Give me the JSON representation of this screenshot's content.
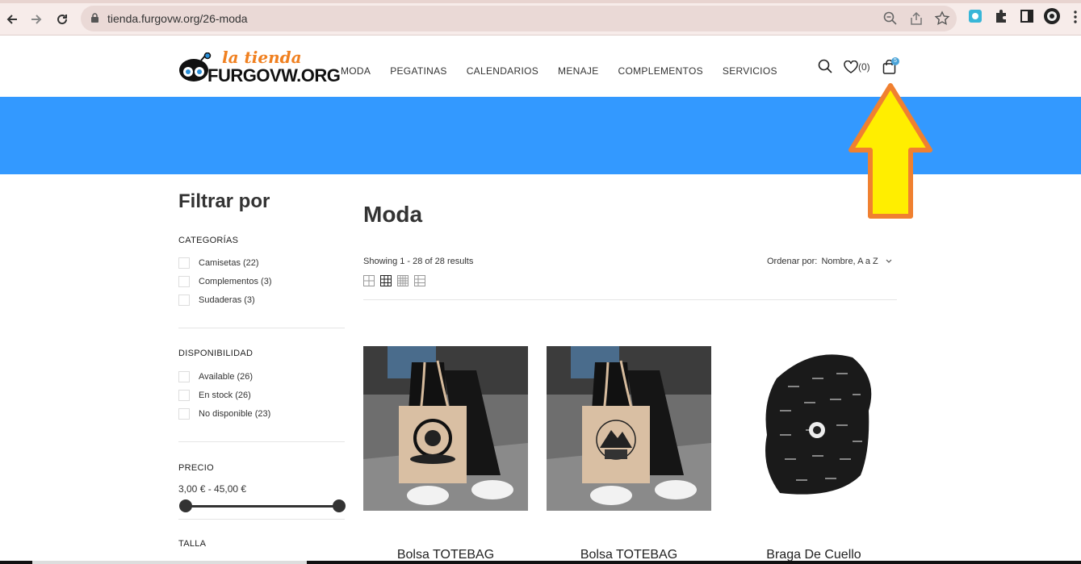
{
  "browser": {
    "url": "tienda.furgovw.org/26-moda"
  },
  "logo": {
    "tagline": "la tienda",
    "name": "FURGOVW.ORG"
  },
  "menu": [
    "MODA",
    "PEGATINAS",
    "CALENDARIOS",
    "MENAJE",
    "COMPLEMENTOS",
    "SERVICIOS"
  ],
  "header": {
    "wishlist_count": "(0)",
    "cart_count": "5"
  },
  "colors": {
    "banner": "#3399ff",
    "arrow_fill": "#ffee00",
    "arrow_stroke": "#f08030"
  },
  "sidebar": {
    "title": "Filtrar por",
    "categories": {
      "title": "CATEGORÍAS",
      "options": [
        "Camisetas (22)",
        "Complementos (3)",
        "Sudaderas (3)"
      ]
    },
    "availability": {
      "title": "DISPONIBILIDAD",
      "options": [
        "Available (26)",
        "En stock (26)",
        "No disponible (23)"
      ]
    },
    "price": {
      "title": "PRECIO",
      "range": "3,00 € - 45,00 €"
    },
    "size": {
      "title": "TALLA"
    }
  },
  "main": {
    "title": "Moda",
    "results": "Showing 1 - 28 of 28 results",
    "sort_label": "Ordenar por:",
    "sort_value": "Nombre, A a Z",
    "products": [
      "Bolsa TOTEBAG",
      "Bolsa TOTEBAG",
      "Braga De Cuello"
    ]
  }
}
